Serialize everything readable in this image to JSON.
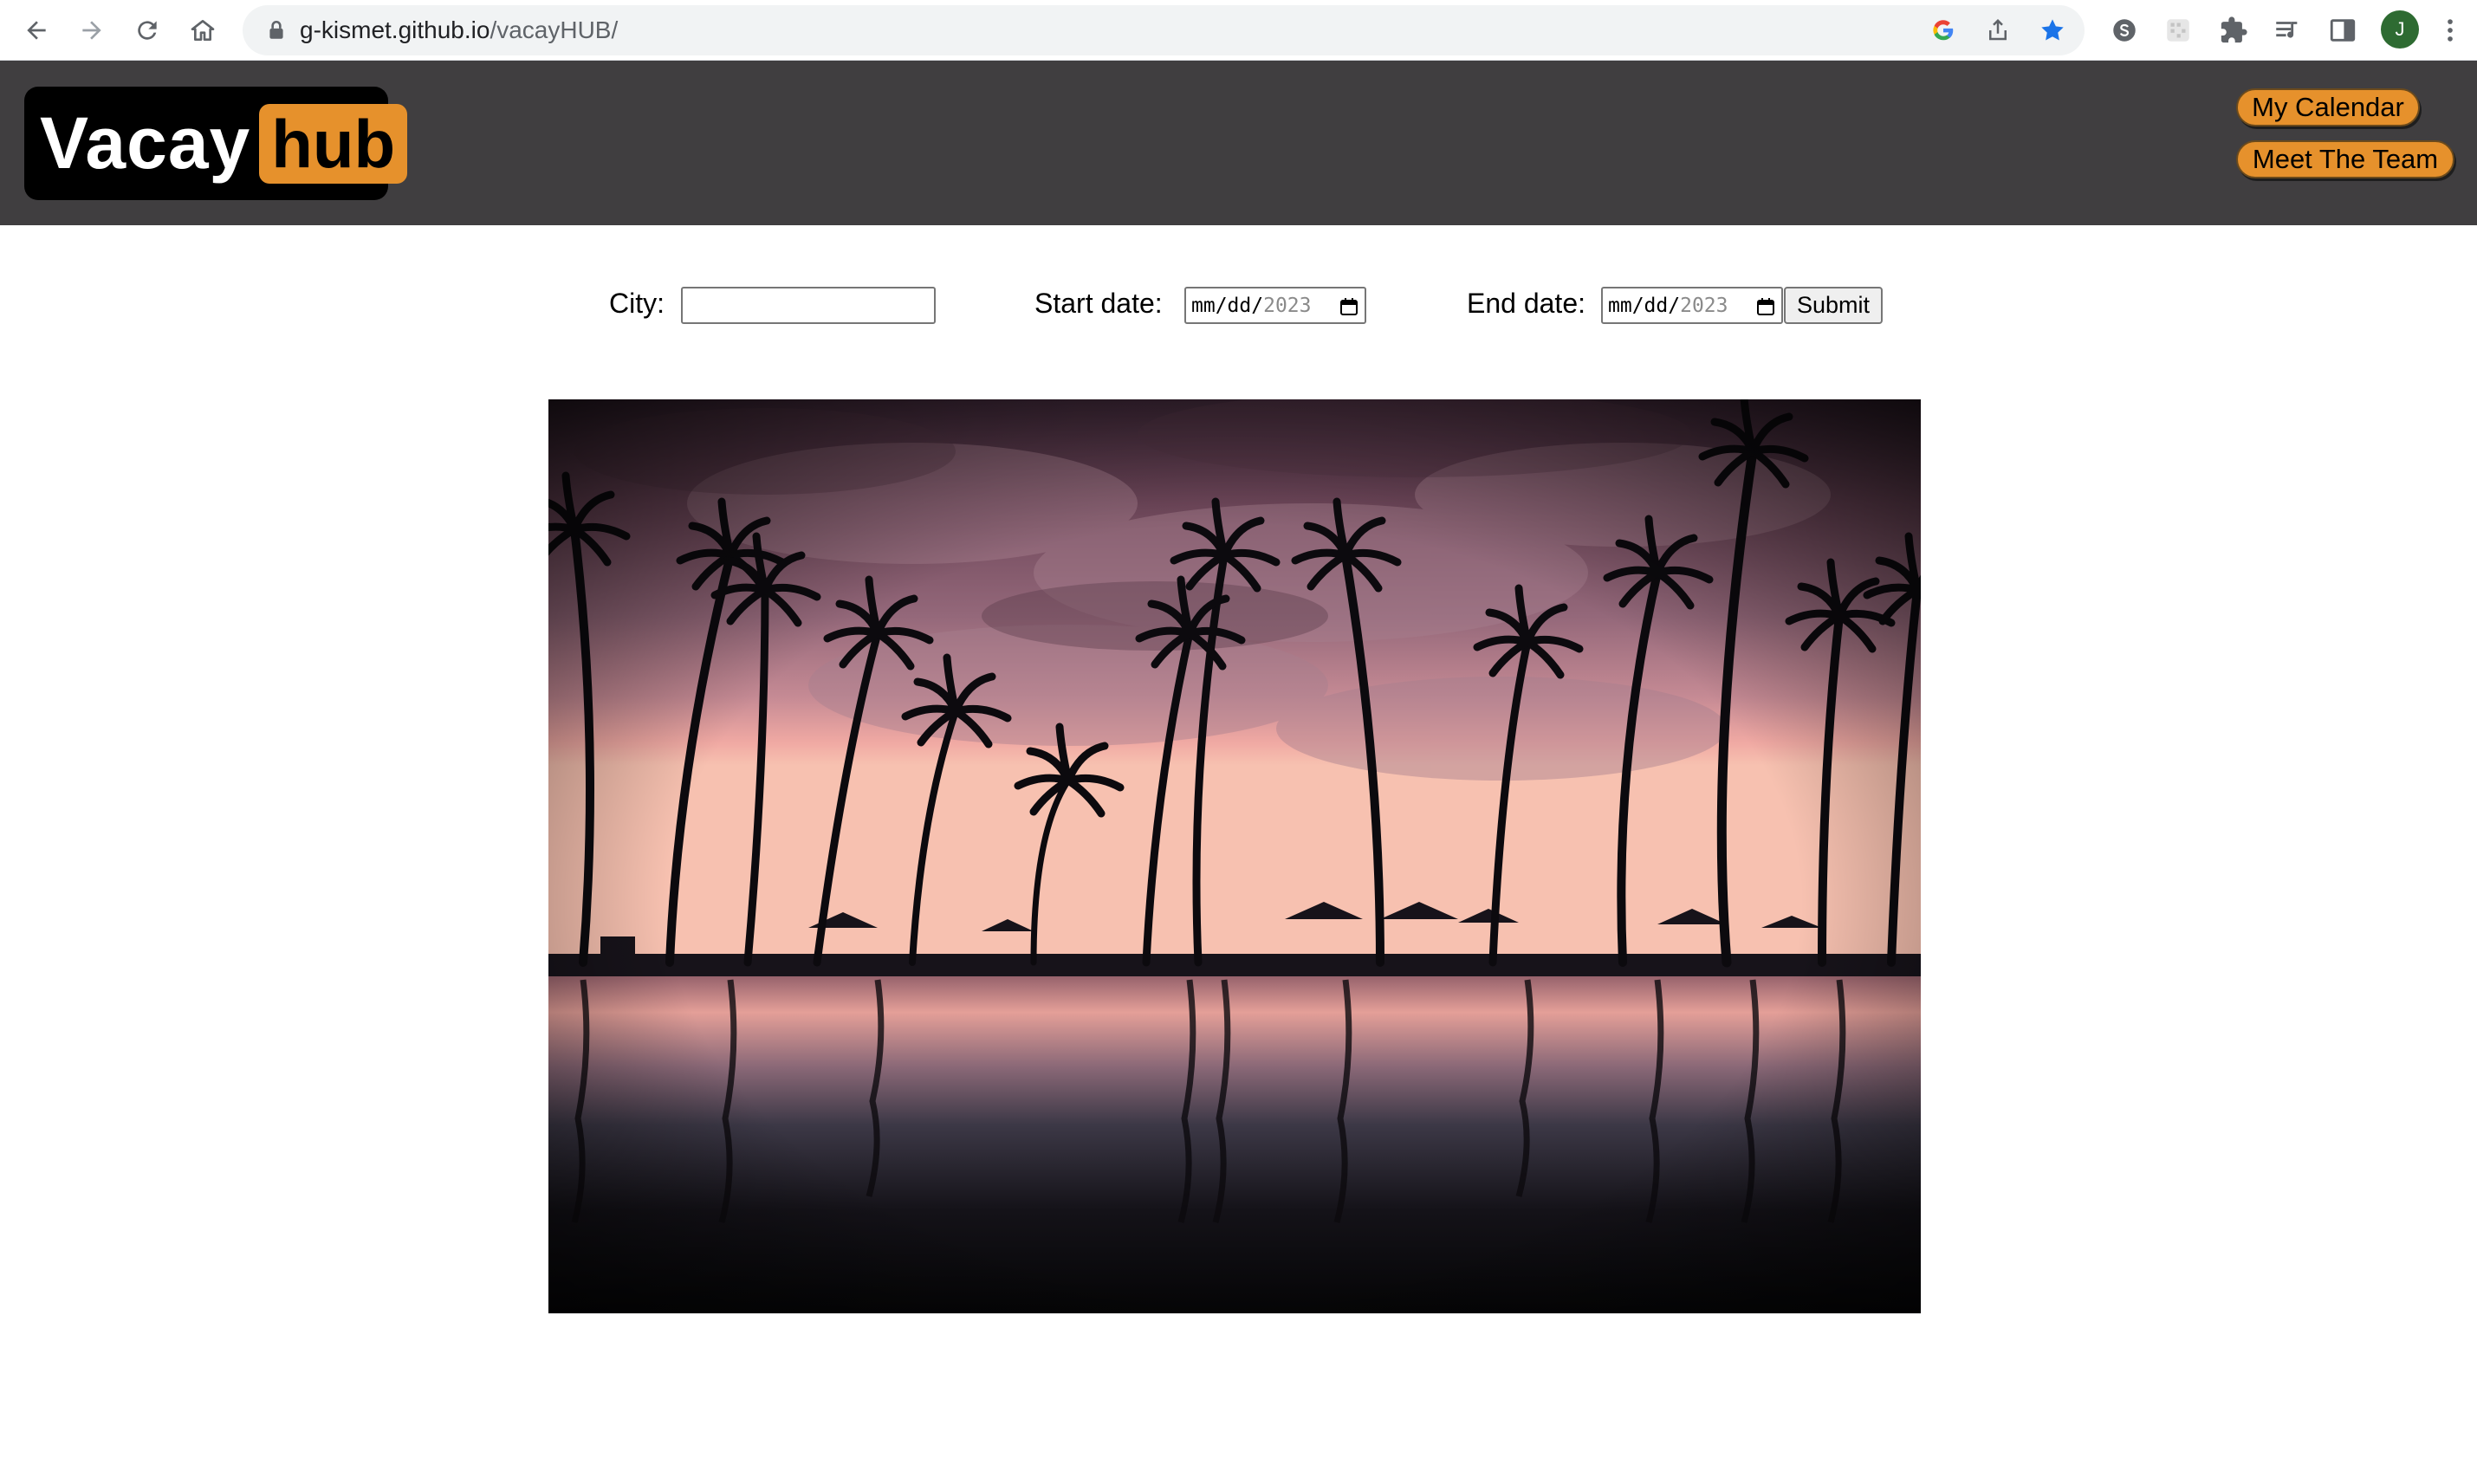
{
  "browser": {
    "url_host": "g-kismet.github.io",
    "url_path": "/vacayHUB/",
    "avatar_initial": "J",
    "icons": [
      "back-icon",
      "forward-icon",
      "reload-icon",
      "home-icon",
      "lock-icon",
      "google-icon",
      "share-icon",
      "bookmark-star-icon",
      "skype-icon",
      "extension-icon",
      "puzzle-icon",
      "media-icon",
      "side-panel-icon",
      "menu-icon"
    ]
  },
  "header": {
    "logo_left": "Vacay",
    "logo_right": "hub",
    "nav_buttons": [
      "My Calendar",
      "Meet The Team"
    ],
    "colors": {
      "bar": "#403e40",
      "accent": "#e6912c",
      "logo_bg": "#000000"
    }
  },
  "form": {
    "city_label": "City:",
    "city_value": "",
    "start_label": "Start date:",
    "end_label": "End date:",
    "date_placeholder_md": "mm/dd/",
    "date_placeholder_year": "2023",
    "submit_label": "Submit"
  },
  "hero": {
    "alt": "Palm trees silhouetted against a pink sunset sky reflected in a pool"
  }
}
